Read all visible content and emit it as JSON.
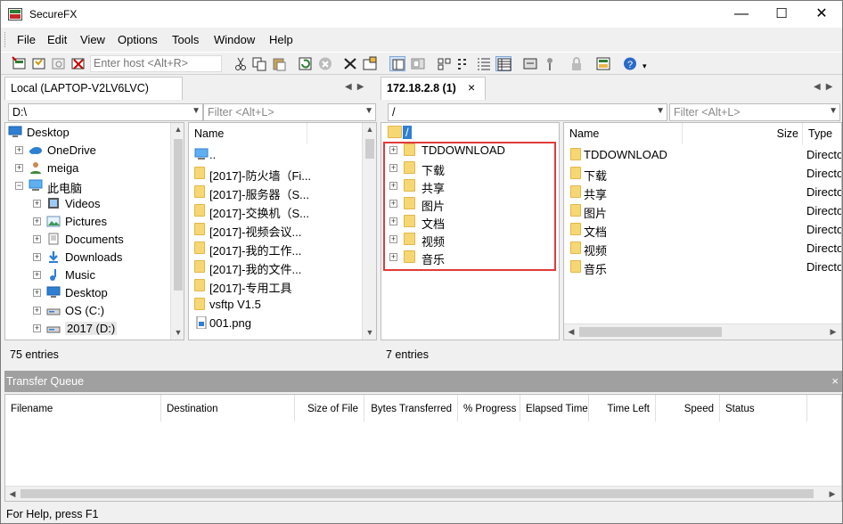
{
  "window": {
    "title": "SecureFX",
    "minimize": "—",
    "maximize": "☐",
    "close": "✕"
  },
  "menu": [
    "File",
    "Edit",
    "View",
    "Options",
    "Tools",
    "Window",
    "Help"
  ],
  "toolbar": {
    "host_placeholder": "Enter host <Alt+R>"
  },
  "left": {
    "tab": "Local (LAPTOP-V2LV6LVC)",
    "path": "D:\\",
    "filter_placeholder": "Filter <Alt+L>",
    "tree": [
      {
        "label": "Desktop",
        "icon": "desktop-icon",
        "level": 0,
        "expander": ""
      },
      {
        "label": "OneDrive",
        "icon": "cloud-icon",
        "level": 1,
        "expander": "+"
      },
      {
        "label": "meiga",
        "icon": "user-icon",
        "level": 1,
        "expander": "+"
      },
      {
        "label": "此电脑",
        "icon": "computer-icon",
        "level": 1,
        "expander": "−"
      },
      {
        "label": "Videos",
        "icon": "video-icon",
        "level": 2,
        "expander": "+"
      },
      {
        "label": "Pictures",
        "icon": "pictures-icon",
        "level": 2,
        "expander": "+"
      },
      {
        "label": "Documents",
        "icon": "documents-icon",
        "level": 2,
        "expander": "+"
      },
      {
        "label": "Downloads",
        "icon": "download-icon",
        "level": 2,
        "expander": "+"
      },
      {
        "label": "Music",
        "icon": "music-icon",
        "level": 2,
        "expander": "+"
      },
      {
        "label": "Desktop",
        "icon": "desktop-icon",
        "level": 2,
        "expander": "+"
      },
      {
        "label": "OS (C:)",
        "icon": "drive-icon",
        "level": 2,
        "expander": "+"
      },
      {
        "label": "2017 (D:)",
        "icon": "drive-icon",
        "level": 2,
        "expander": "+"
      }
    ],
    "list_header": "Name",
    "list": [
      {
        "name": "..",
        "icon": "parent-folder-icon"
      },
      {
        "name": "[2017]-防火墙（Fi...",
        "icon": "folder-icon"
      },
      {
        "name": "[2017]-服务器（S...",
        "icon": "folder-icon"
      },
      {
        "name": "[2017]-交换机（S...",
        "icon": "folder-icon"
      },
      {
        "name": "[2017]-视频会议...",
        "icon": "folder-icon"
      },
      {
        "name": "[2017]-我的工作...",
        "icon": "folder-icon"
      },
      {
        "name": "[2017]-我的文件...",
        "icon": "folder-icon"
      },
      {
        "name": "[2017]-专用工具",
        "icon": "folder-icon"
      },
      {
        "name": "vsftp V1.5",
        "icon": "folder-icon"
      },
      {
        "name": "001.png",
        "icon": "image-file-icon"
      }
    ],
    "status": "75 entries"
  },
  "right": {
    "tab": "172.18.2.8 (1)",
    "path": "/",
    "filter_placeholder": "Filter <Alt+L>",
    "tree_root": "/",
    "tree": [
      "TDDOWNLOAD",
      "下载",
      "共享",
      "图片",
      "文档",
      "视频",
      "音乐"
    ],
    "columns": {
      "name": "Name",
      "size": "Size",
      "type": "Type"
    },
    "list": [
      "TDDOWNLOAD",
      "下载",
      "共享",
      "图片",
      "文档",
      "视频",
      "音乐"
    ],
    "type_value": "Directo",
    "status": "7 entries"
  },
  "queue": {
    "title": "Transfer Queue",
    "columns": [
      "Filename",
      "Destination",
      "Size of File",
      "Bytes Transferred",
      "% Progress",
      "Elapsed Time",
      "Time Left",
      "Speed",
      "Status"
    ]
  },
  "statusbar": "For Help, press F1"
}
